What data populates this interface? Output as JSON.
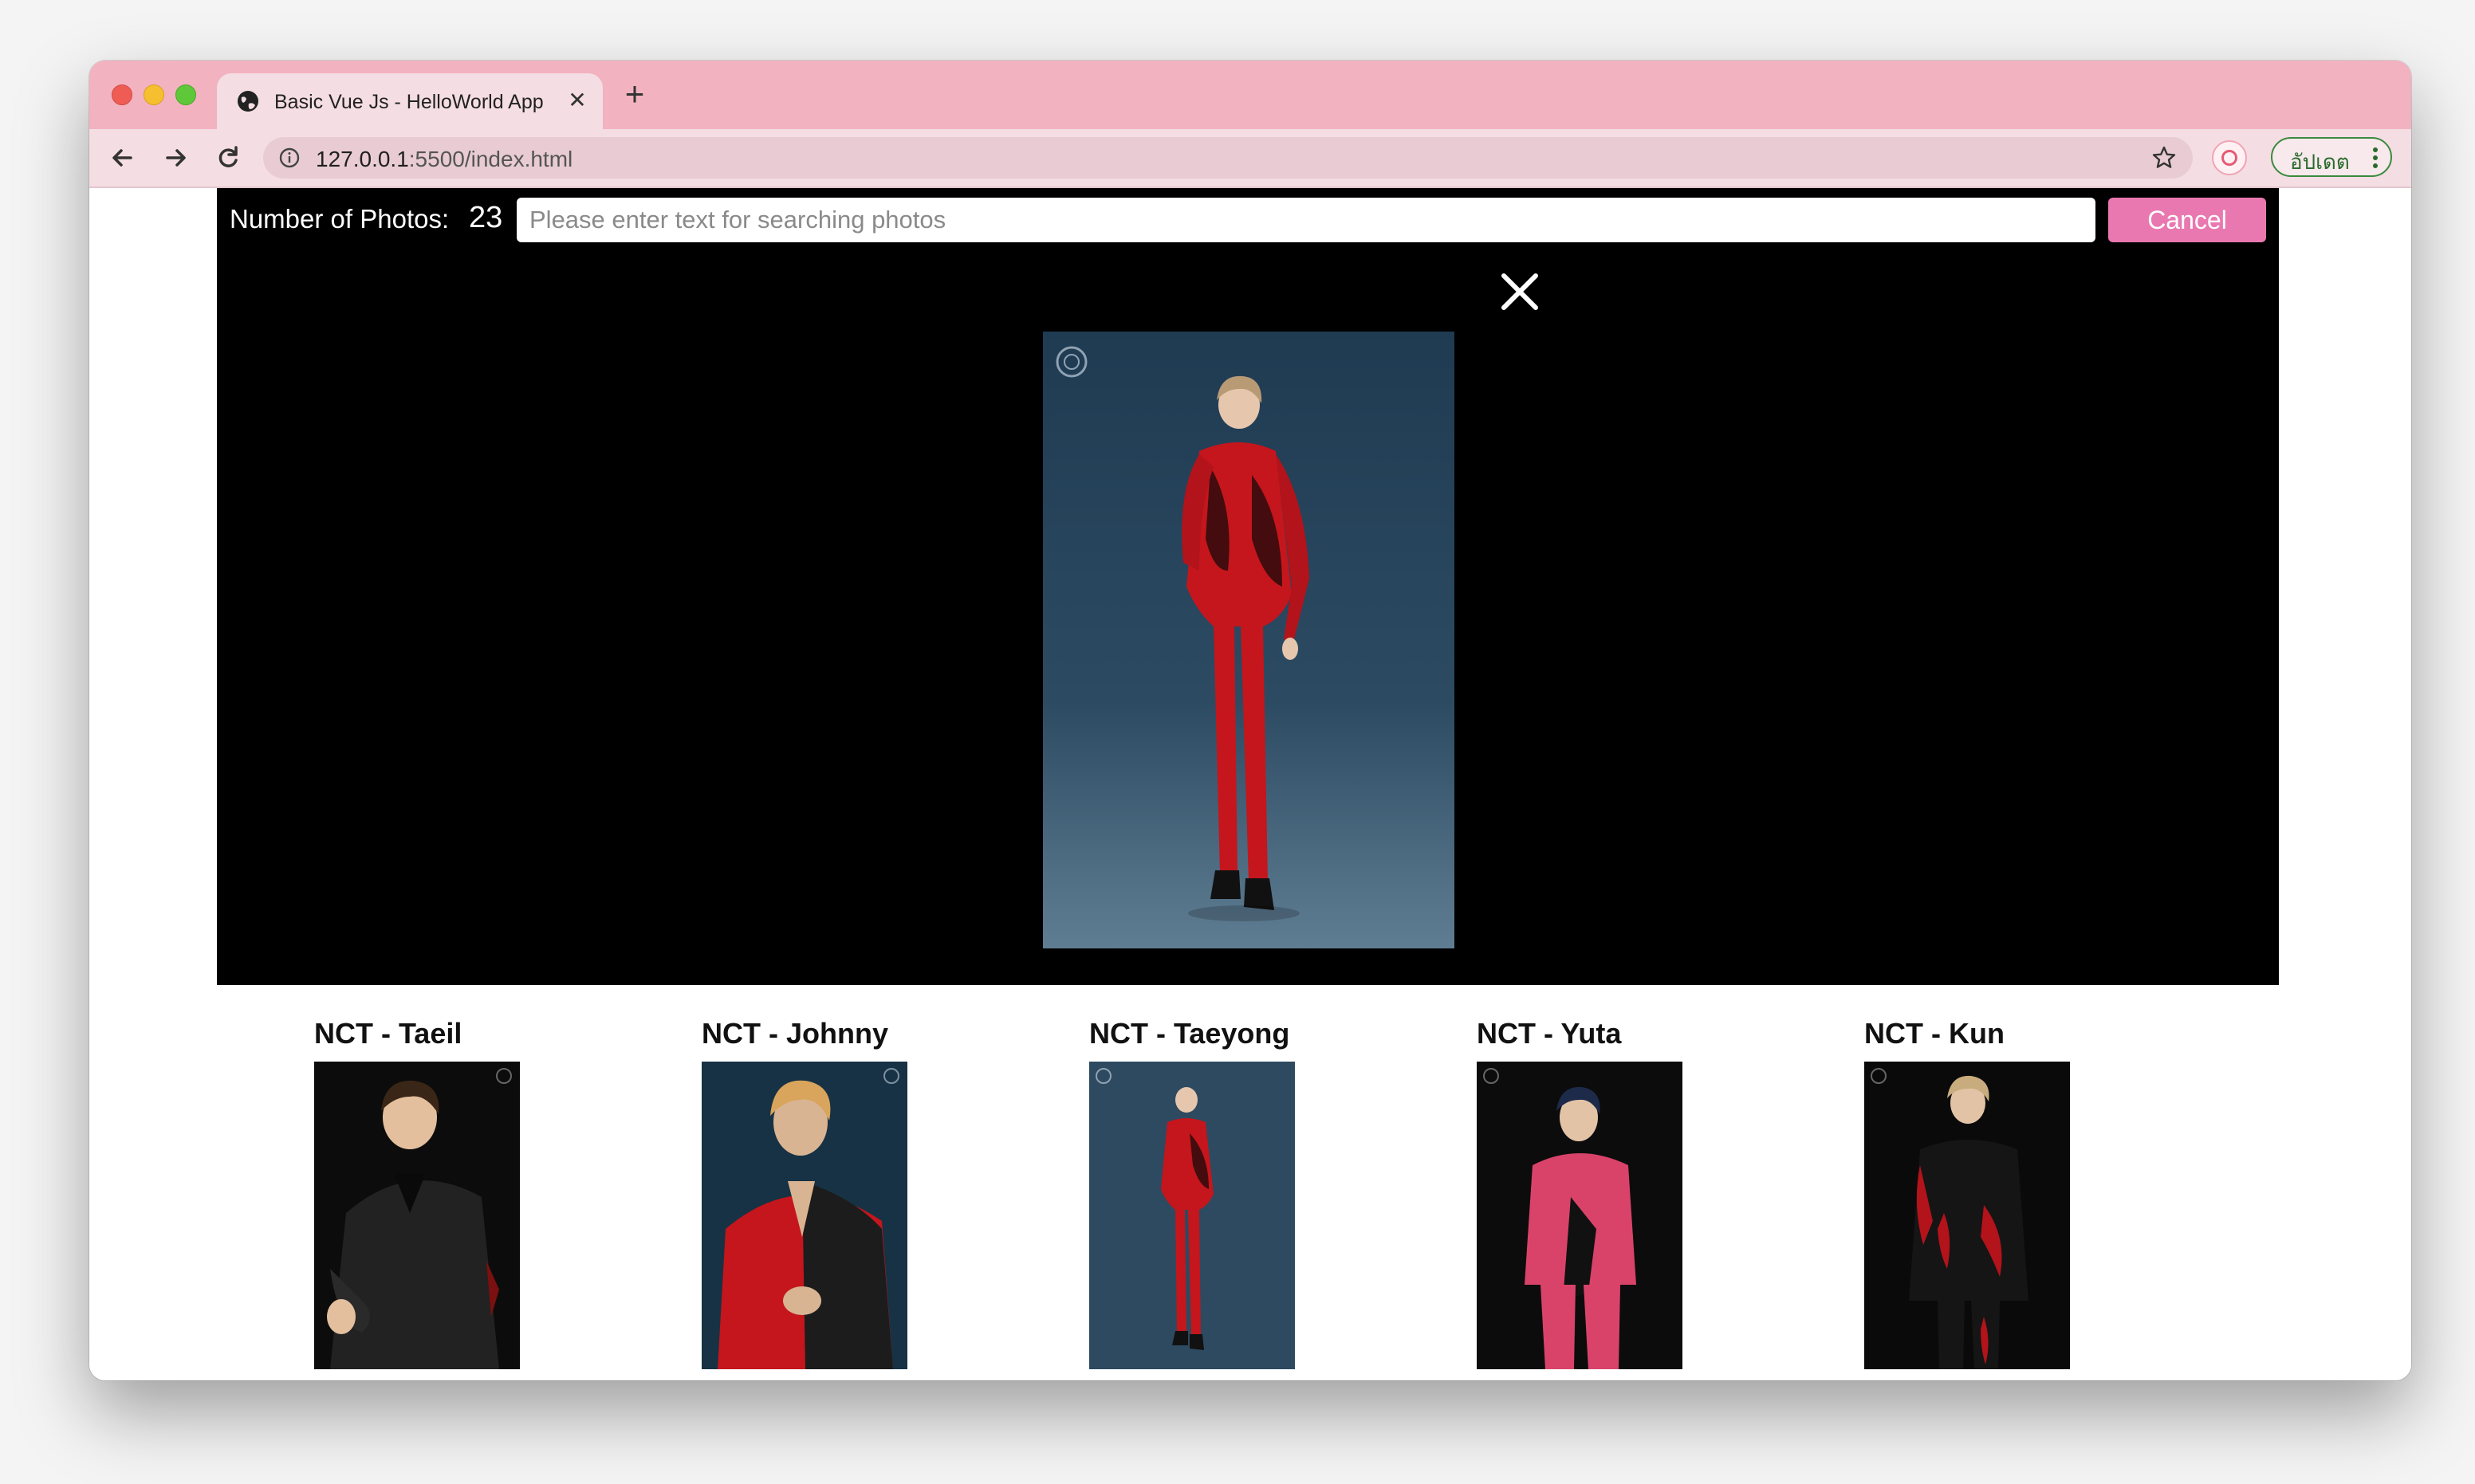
{
  "browser": {
    "tab_title": "Basic Vue Js - HelloWorld App",
    "url_host": "127.0.0.1",
    "url_path": ":5500/index.html",
    "update_label": "อัปเดต",
    "accent_color": "#f2b2c0"
  },
  "app": {
    "count_label": "Number of Photos:",
    "count_value": "23",
    "search_placeholder": "Please enter text for searching photos",
    "search_value": "",
    "cancel_label": "Cancel",
    "cancel_color": "#e978b0"
  },
  "lightbox": {
    "close_icon": "close-icon",
    "photo_subject": "Taeyong"
  },
  "gallery": {
    "items": [
      {
        "name": "NCT - Taeil",
        "outfit": "#1a1a1a",
        "bg": "#0c0c0c"
      },
      {
        "name": "NCT - Johnny",
        "outfit": "#c4161c",
        "bg": "#173244"
      },
      {
        "name": "NCT - Taeyong",
        "outfit": "#c4161c",
        "bg": "#2d4a60"
      },
      {
        "name": "NCT - Yuta",
        "outfit": "#d9436a",
        "bg": "#0c0c0c"
      },
      {
        "name": "NCT - Kun",
        "outfit": "#111111",
        "bg": "#0a0a0a"
      }
    ]
  }
}
